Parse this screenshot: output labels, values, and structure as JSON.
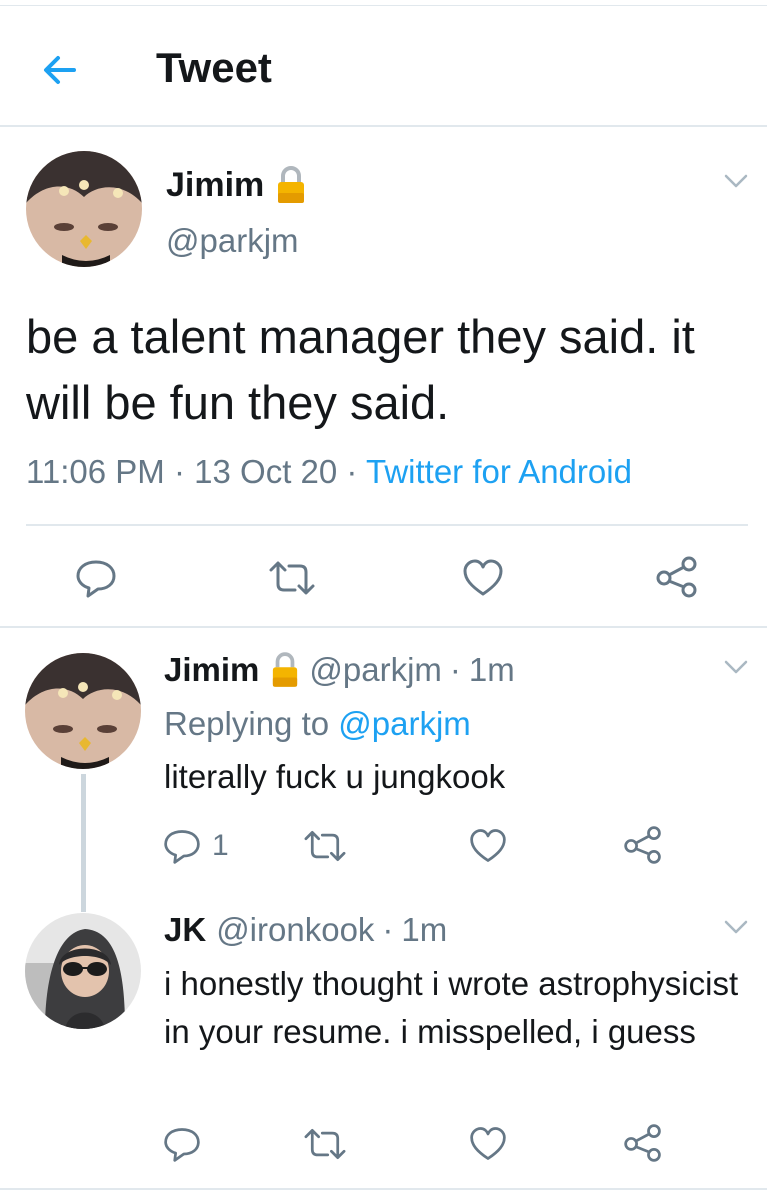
{
  "header": {
    "title": "Tweet",
    "back_icon": "arrow-left-icon",
    "accent": "#1da1f2"
  },
  "main_tweet": {
    "name": "Jimim",
    "lock_icon": "lock-icon",
    "handle": "@parkjm",
    "text": "be a talent manager they said. it will be fun they said.",
    "time": "11:06 PM",
    "date": "13 Oct 20",
    "source": "Twitter for Android",
    "actions": [
      "reply-icon",
      "retweet-icon",
      "like-icon",
      "share-icon"
    ]
  },
  "replies": [
    {
      "name": "Jimim",
      "handle": "@parkjm",
      "age": "1m",
      "replying_label": "Replying to",
      "replying_to": "@parkjm",
      "text": "literally fuck u jungkook",
      "reply_count": "1"
    },
    {
      "name": "JK",
      "handle": "@ironkook",
      "age": "1m",
      "text": "i honestly thought i wrote astrophysicist in your resume. i misspelled, i guess"
    }
  ],
  "colors": {
    "text": "#14171a",
    "secondary": "#657786",
    "link": "#1da1f2",
    "divider": "#e1e8ed",
    "lock": "#f4b400"
  }
}
